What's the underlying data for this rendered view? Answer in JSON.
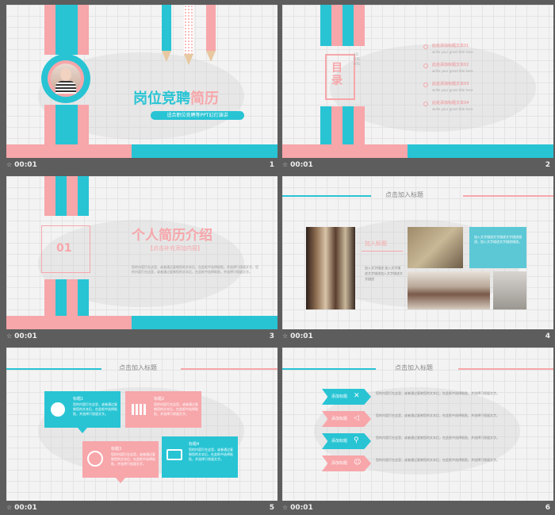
{
  "slides": [
    {
      "num": "1",
      "time": "00:01",
      "title_a": "岗位竞聘",
      "title_b": "简历",
      "subtitle": "适合职位竞聘等PPT幻灯演讲"
    },
    {
      "num": "2",
      "time": "00:01",
      "toc_title": "目录",
      "toc_en": "CONTENTS",
      "items": [
        {
          "label": "此处添加标题文本01",
          "sub": "write your great title here"
        },
        {
          "label": "此处添加标题文本02",
          "sub": "write your great title here"
        },
        {
          "label": "此处添加标题文本03",
          "sub": "write your great title here"
        },
        {
          "label": "此处添加标题文本04",
          "sub": "write your great title here"
        }
      ]
    },
    {
      "num": "3",
      "time": "00:01",
      "section_num": "01",
      "title": "个人简历介绍",
      "subtitle": "【点击补充添加内容】",
      "body": "您的内容打在这里，或者通过复制您的文本后，在此框中选择粘贴，并选择只保留文字。您的内容打在这里，或者通过复制您的文本后，在此框中选择粘贴，并选择只保留文字。"
    },
    {
      "num": "4",
      "time": "00:01",
      "header": "点击加入标题",
      "caption_title": "加入标题",
      "caption_body": "加入文字描述 加入文字描述文字描述加入文字描述文字描述",
      "side_text": "加入文字描述文字描述文字描述描述。加入文字描述文字描述描述。"
    },
    {
      "num": "5",
      "time": "00:01",
      "header": "点击加入标题",
      "cards": [
        {
          "title": "标题1",
          "body": "您的内容打在这里，或者通过复制您的文本后，在此框中选择粘贴，并选择只保留文字。"
        },
        {
          "title": "标题2",
          "body": "您的内容打在这里，或者通过复制您的文本后，在此框中选择粘贴，并选择只保留文字。"
        },
        {
          "title": "标题3",
          "body": "您的内容打在这里，或者通过复制您的文本后，在此框中选择粘贴，并选择只保留文字。"
        },
        {
          "title": "标题4",
          "body": "您的内容打在这里，或者通过复制您的文本后，在此框中选择粘贴，并选择只保留文字。"
        }
      ]
    },
    {
      "num": "6",
      "time": "00:01",
      "header": "点击加入标题",
      "rows": [
        {
          "tag": "添加标题",
          "text": "您的内容打在这里，或者通过复制您的文本后，在此框中选择粘贴，并选择只保留文字。"
        },
        {
          "tag": "添加标题",
          "text": "您的内容打在这里，或者通过复制您的文本后，在此框中选择粘贴，并选择只保留文字。"
        },
        {
          "tag": "添加标题",
          "text": "您的内容打在这里，或者通过复制您的文本后，在此框中选择粘贴，并选择只保留文字。"
        },
        {
          "tag": "添加标题",
          "text": "您的内容打在这里，或者通过复制您的文本后，在此框中选择粘贴，并选择只保留文字。"
        }
      ]
    }
  ]
}
